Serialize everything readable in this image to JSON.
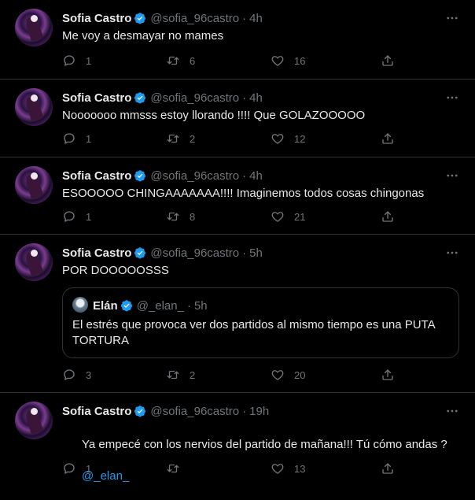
{
  "colors": {
    "background": "#000000",
    "text": "#e7e9ea",
    "muted": "#71767b",
    "accent": "#1d9bf0",
    "border": "#2f3336"
  },
  "tweets": [
    {
      "name": "Sofia Castro",
      "handle": "@sofia_96castro",
      "sep": "·",
      "time": "4h",
      "text": "Me voy a desmayar no mames",
      "replies": "1",
      "retweets": "6",
      "likes": "16"
    },
    {
      "name": "Sofia Castro",
      "handle": "@sofia_96castro",
      "sep": "·",
      "time": "4h",
      "text": "Nooooooo mmsss estoy llorando !!!! Que GOLAZOOOOO",
      "replies": "1",
      "retweets": "2",
      "likes": "12"
    },
    {
      "name": "Sofia Castro",
      "handle": "@sofia_96castro",
      "sep": "·",
      "time": "4h",
      "text": "ESOOOOO CHINGAAAAAAA!!!! Imaginemos todos cosas chingonas",
      "replies": "1",
      "retweets": "8",
      "likes": "21"
    },
    {
      "name": "Sofia Castro",
      "handle": "@sofia_96castro",
      "sep": "·",
      "time": "5h",
      "text": "POR DOOOOOSSS",
      "quote": {
        "name": "Elán",
        "handle": "@_elan_",
        "sep": "·",
        "time": "5h",
        "text": "El estrés que provoca ver dos partidos al mismo tiempo es una PUTA TORTURA"
      },
      "replies": "3",
      "retweets": "2",
      "likes": "20"
    },
    {
      "name": "Sofia Castro",
      "handle": "@sofia_96castro",
      "sep": "·",
      "time": "19h",
      "text": "Ya empecé con los nervios del partido de mañana!!! Tú cómo andas ?",
      "mention": "@_elan_",
      "replies": "1",
      "retweets": "",
      "likes": "13"
    }
  ],
  "icons": {
    "verified": "verified-badge-icon",
    "more": "more-dots-icon",
    "reply": "reply-bubble-icon",
    "retweet": "retweet-arrows-icon",
    "like": "heart-icon",
    "share": "share-upload-icon"
  }
}
